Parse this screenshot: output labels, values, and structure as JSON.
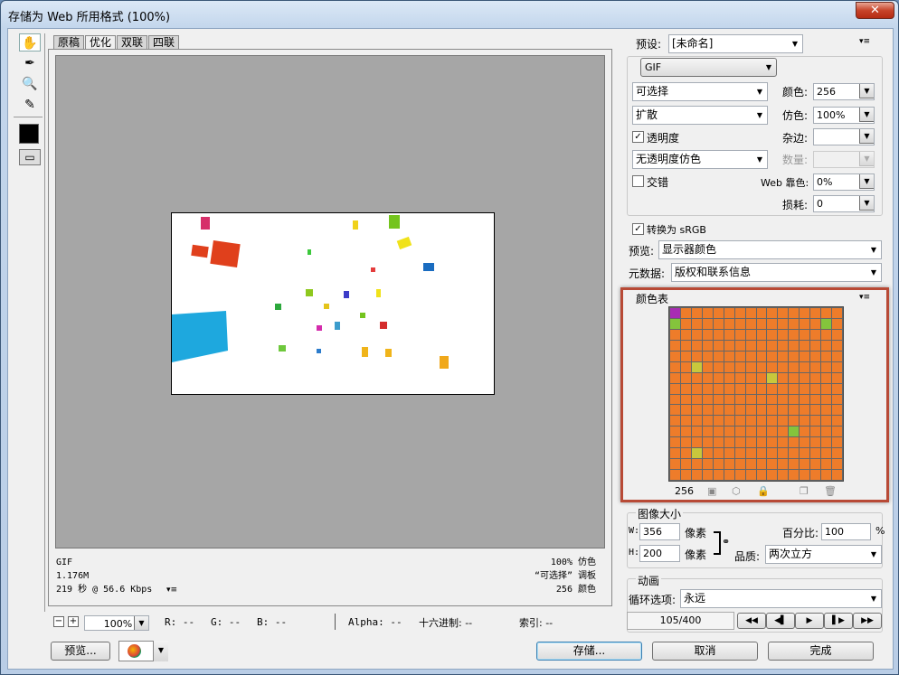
{
  "window": {
    "title": "存储为 Web 所用格式 (100%)",
    "close": "✕"
  },
  "tabs": [
    "原稿",
    "优化",
    "双联",
    "四联"
  ],
  "image_info": {
    "left": [
      "GIF",
      "1.176M",
      "219 秒 @ 56.6 Kbps"
    ],
    "right": [
      "100% 仿色",
      "“可选择” 调板",
      "256 颜色"
    ],
    "menu_icon": "▾≡"
  },
  "statusbar": {
    "zoom": "100%",
    "r": "R: --",
    "g": "G: --",
    "b": "B: --",
    "alpha": "Alpha: --",
    "hex": "十六进制: --",
    "index": "索引: --"
  },
  "bottom": {
    "preview": "预览...",
    "save": "存储...",
    "cancel": "取消",
    "done": "完成"
  },
  "settings": {
    "preset_label": "预设:",
    "preset_value": "[未命名]",
    "format": "GIF",
    "reduction": "可选择",
    "colors_label": "颜色:",
    "colors_value": "256",
    "dither_algo": "扩散",
    "dither_label": "仿色:",
    "dither_value": "100%",
    "transparency_label": "透明度",
    "transparency_checked": "✓",
    "matte_label": "杂边:",
    "matte_value": "",
    "transp_dither": "无透明度仿色",
    "amount_label": "数量:",
    "amount_value": "",
    "interlaced_label": "交错",
    "websnap_label": "Web 靠色:",
    "websnap_value": "0%",
    "lossy_label": "损耗:",
    "lossy_value": "0",
    "convert_srgb_label": "转换为 sRGB",
    "convert_srgb_checked": "✓",
    "preview_label": "预览:",
    "preview_value": "显示器颜色",
    "metadata_label": "元数据:",
    "metadata_value": "版权和联系信息"
  },
  "color_table": {
    "title": "颜色表",
    "count": "256",
    "colors": [
      "#ee7c2a",
      "#1f9bd8",
      "#4aa84a",
      "#7a7a2a",
      "#e84a88",
      "#8ac63a",
      "#9b8ed0",
      "#d43c3c",
      "#e86c2c",
      "#4c8cd4",
      "#9cd4a0",
      "#c8b428",
      "#3ab8c8",
      "#ec4cac",
      "#d4d4d4",
      "#7ca4b4",
      "#f0c832",
      "#289c3c",
      "#f04c4c",
      "#2c74c8",
      "#a82cb4",
      "#58d470",
      "#ec9c3c",
      "#4cc0ec",
      "#84c43c",
      "#c8c83c",
      "#4ca4a4",
      "#e4e4e4",
      "#cc2c2c",
      "#f0e43c",
      "#3cd4d4",
      "#ac6c3c"
    ]
  },
  "image_size": {
    "title": "图像大小",
    "w_label": "W:",
    "w_value": "356",
    "w_unit": "像素",
    "h_label": "H:",
    "h_value": "200",
    "h_unit": "像素",
    "percent_label": "百分比:",
    "percent_value": "100",
    "percent_unit": "%",
    "quality_label": "品质:",
    "quality_value": "两次立方"
  },
  "animation": {
    "title": "动画",
    "loop_label": "循环选项:",
    "loop_value": "永远",
    "frame": "105/400",
    "controls": [
      "◀◀",
      "◀▌",
      "▶",
      "▌▶",
      "▶▶"
    ]
  },
  "menu_icon": "▾≡"
}
